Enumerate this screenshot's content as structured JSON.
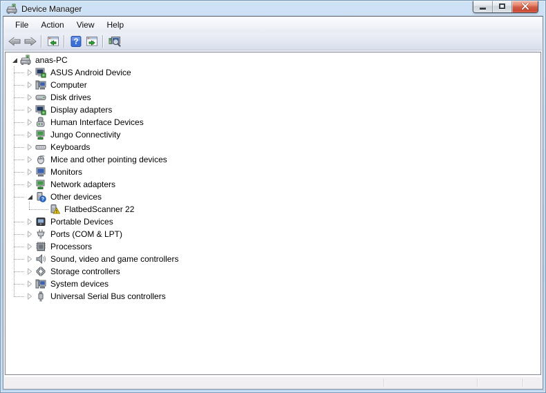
{
  "window": {
    "title": "Device Manager",
    "app_icon": "device-manager-icon",
    "controls": [
      {
        "name": "minimize"
      },
      {
        "name": "maximize"
      },
      {
        "name": "close"
      }
    ]
  },
  "menu": {
    "items": [
      {
        "label": "File"
      },
      {
        "label": "Action"
      },
      {
        "label": "View"
      },
      {
        "label": "Help"
      }
    ]
  },
  "toolbar": {
    "buttons": [
      {
        "name": "back",
        "icon": "back-arrow-icon"
      },
      {
        "name": "forward",
        "icon": "forward-arrow-icon"
      },
      {
        "name": "show-hide-console-tree",
        "icon": "console-tree-icon"
      },
      {
        "name": "help",
        "icon": "help-icon"
      },
      {
        "name": "show-hide-action-pane",
        "icon": "action-pane-icon"
      },
      {
        "name": "scan-for-hardware-changes",
        "icon": "scan-hardware-icon"
      }
    ]
  },
  "tree": {
    "items": [
      {
        "label": "anas-PC",
        "level": 0,
        "state": "expanded",
        "icon": "computer-icon"
      },
      {
        "label": "ASUS Android Device",
        "level": 1,
        "state": "collapsed",
        "icon": "display-adapter-icon"
      },
      {
        "label": "Computer",
        "level": 1,
        "state": "collapsed",
        "icon": "computer-monitor-icon"
      },
      {
        "label": "Disk drives",
        "level": 1,
        "state": "collapsed",
        "icon": "disk-drive-icon"
      },
      {
        "label": "Display adapters",
        "level": 1,
        "state": "collapsed",
        "icon": "display-adapter-icon"
      },
      {
        "label": "Human Interface Devices",
        "level": 1,
        "state": "collapsed",
        "icon": "hid-device-icon"
      },
      {
        "label": "Jungo Connectivity",
        "level": 1,
        "state": "collapsed",
        "icon": "network-adapter-icon"
      },
      {
        "label": "Keyboards",
        "level": 1,
        "state": "collapsed",
        "icon": "keyboard-icon"
      },
      {
        "label": "Mice and other pointing devices",
        "level": 1,
        "state": "collapsed",
        "icon": "mouse-icon"
      },
      {
        "label": "Monitors",
        "level": 1,
        "state": "collapsed",
        "icon": "monitor-icon"
      },
      {
        "label": "Network adapters",
        "level": 1,
        "state": "collapsed",
        "icon": "network-adapter-icon"
      },
      {
        "label": "Other devices",
        "level": 1,
        "state": "expanded",
        "icon": "unknown-device-icon"
      },
      {
        "label": "FlatbedScanner 22",
        "level": 2,
        "state": "none",
        "icon": "unknown-device-warning-icon"
      },
      {
        "label": "Portable Devices",
        "level": 1,
        "state": "collapsed",
        "icon": "portable-device-icon"
      },
      {
        "label": "Ports (COM & LPT)",
        "level": 1,
        "state": "collapsed",
        "icon": "serial-port-icon"
      },
      {
        "label": "Processors",
        "level": 1,
        "state": "collapsed",
        "icon": "processor-icon"
      },
      {
        "label": "Sound, video and game controllers",
        "level": 1,
        "state": "collapsed",
        "icon": "speaker-icon"
      },
      {
        "label": "Storage controllers",
        "level": 1,
        "state": "collapsed",
        "icon": "storage-controller-icon"
      },
      {
        "label": "System devices",
        "level": 1,
        "state": "collapsed",
        "icon": "computer-monitor-icon"
      },
      {
        "label": "Universal Serial Bus controllers",
        "level": 1,
        "state": "collapsed",
        "icon": "usb-controller-icon"
      }
    ]
  },
  "statusbar": {
    "text": ""
  },
  "colors": {
    "titlebar": "#bcd5ee",
    "close_button": "#cb4934",
    "help_icon": "#3a6fd8",
    "warning_badge": "#f7d117",
    "question_badge": "#2f6fd0",
    "tree_background": "#ffffff",
    "status_background": "#f1eff2"
  }
}
